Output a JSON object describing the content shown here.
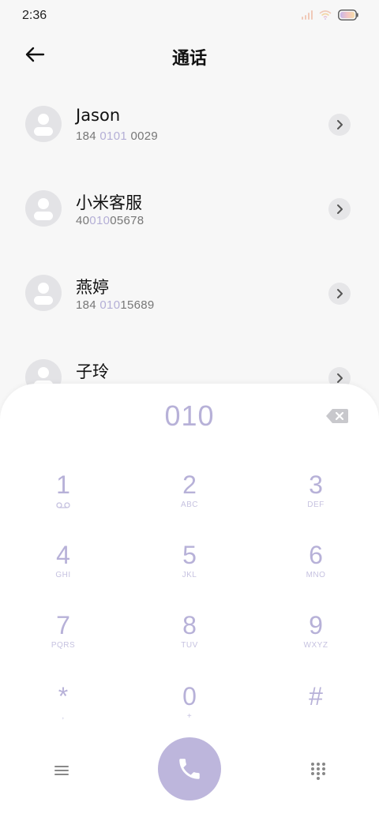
{
  "status_bar": {
    "time": "2:36"
  },
  "header": {
    "title": "通话"
  },
  "contacts": [
    {
      "name": "Jason",
      "number_parts": [
        "184 ",
        "0101",
        " 0029"
      ]
    },
    {
      "name": "小米客服",
      "number_parts": [
        "40",
        "010",
        "05678"
      ]
    },
    {
      "name": "燕婷",
      "number_parts": [
        "184 ",
        "010",
        "15689"
      ]
    },
    {
      "name": "子玲",
      "number_parts": [
        "",
        "",
        ""
      ]
    }
  ],
  "dialpad": {
    "dialed_number": "010",
    "keys": [
      {
        "digit": "1",
        "letters": ""
      },
      {
        "digit": "2",
        "letters": "ABC"
      },
      {
        "digit": "3",
        "letters": "DEF"
      },
      {
        "digit": "4",
        "letters": "GHI"
      },
      {
        "digit": "5",
        "letters": "JKL"
      },
      {
        "digit": "6",
        "letters": "MNO"
      },
      {
        "digit": "7",
        "letters": "PQRS"
      },
      {
        "digit": "8",
        "letters": "TUV"
      },
      {
        "digit": "9",
        "letters": "WXYZ"
      },
      {
        "digit": "*",
        "letters": ","
      },
      {
        "digit": "0",
        "letters": "+"
      },
      {
        "digit": "#",
        "letters": ""
      }
    ]
  },
  "colors": {
    "accent": "#b7b1d8",
    "call_button": "#bdb6dc",
    "highlight": "#b4afd6"
  },
  "icons": {
    "back": "arrow-left-icon",
    "chevron": "chevron-right-icon",
    "backspace": "backspace-icon",
    "voicemail": "voicemail-icon",
    "menu": "menu-icon",
    "call": "phone-icon",
    "keypad": "dialpad-icon"
  }
}
